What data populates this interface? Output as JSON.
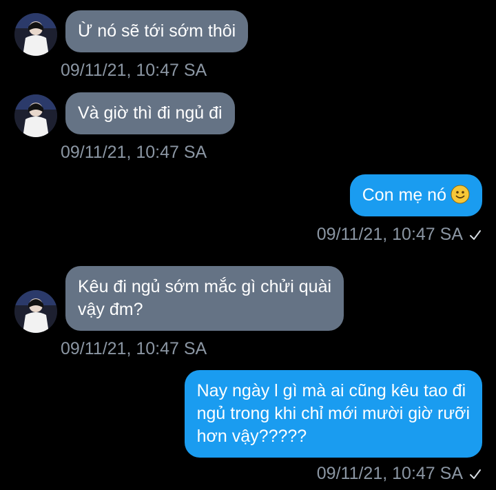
{
  "messages": [
    {
      "direction": "incoming",
      "text": "Ừ nó sẽ tới sớm thôi",
      "timestamp": "09/11/21, 10:47 SA"
    },
    {
      "direction": "incoming",
      "text": "Và giờ thì đi ngủ đi",
      "timestamp": "09/11/21, 10:47 SA"
    },
    {
      "direction": "outgoing",
      "text": "Con mẹ nó",
      "emoji": "slightly-smiling-face",
      "timestamp": "09/11/21, 10:47 SA",
      "read_indicator": "check-icon"
    },
    {
      "direction": "incoming",
      "text": "Kêu đi ngủ sớm mắc gì chửi quài\nvậy đm?",
      "timestamp": "09/11/21, 10:47 SA"
    },
    {
      "direction": "outgoing",
      "text": "Nay ngày l gì mà ai cũng kêu tao đi\nngủ trong khi chỉ mới mười giờ rưỡi\nhơn vậy?????",
      "timestamp": "09/11/21, 10:47 SA",
      "read_indicator": "check-icon"
    }
  ],
  "colors": {
    "background": "#000000",
    "incoming_bubble": "#657385",
    "outgoing_bubble": "#1a9cf0",
    "timestamp": "#8b96a3",
    "bubble_text": "#ffffff"
  }
}
